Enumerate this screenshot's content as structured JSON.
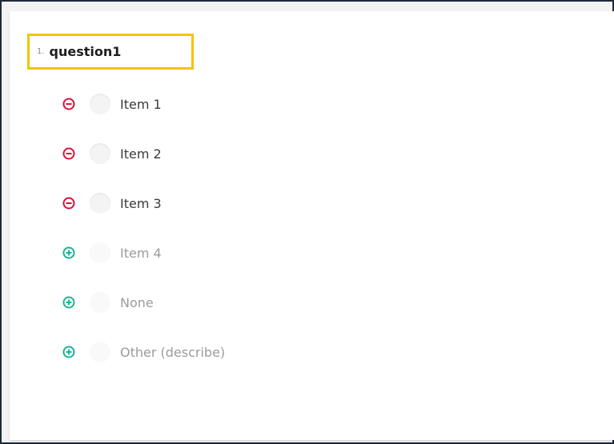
{
  "question": {
    "number": "1.",
    "title": "question1"
  },
  "colors": {
    "remove": "#d8113a",
    "add": "#19b394",
    "highlight": "#f2c500"
  },
  "choices": [
    {
      "label": "Item 1",
      "state": "active",
      "action_icon": "remove-circle-icon"
    },
    {
      "label": "Item 2",
      "state": "active",
      "action_icon": "remove-circle-icon"
    },
    {
      "label": "Item 3",
      "state": "active",
      "action_icon": "remove-circle-icon"
    },
    {
      "label": "Item 4",
      "state": "inactive",
      "action_icon": "add-circle-icon"
    },
    {
      "label": "None",
      "state": "inactive",
      "action_icon": "add-circle-icon"
    },
    {
      "label": "Other (describe)",
      "state": "inactive",
      "action_icon": "add-circle-icon"
    }
  ]
}
